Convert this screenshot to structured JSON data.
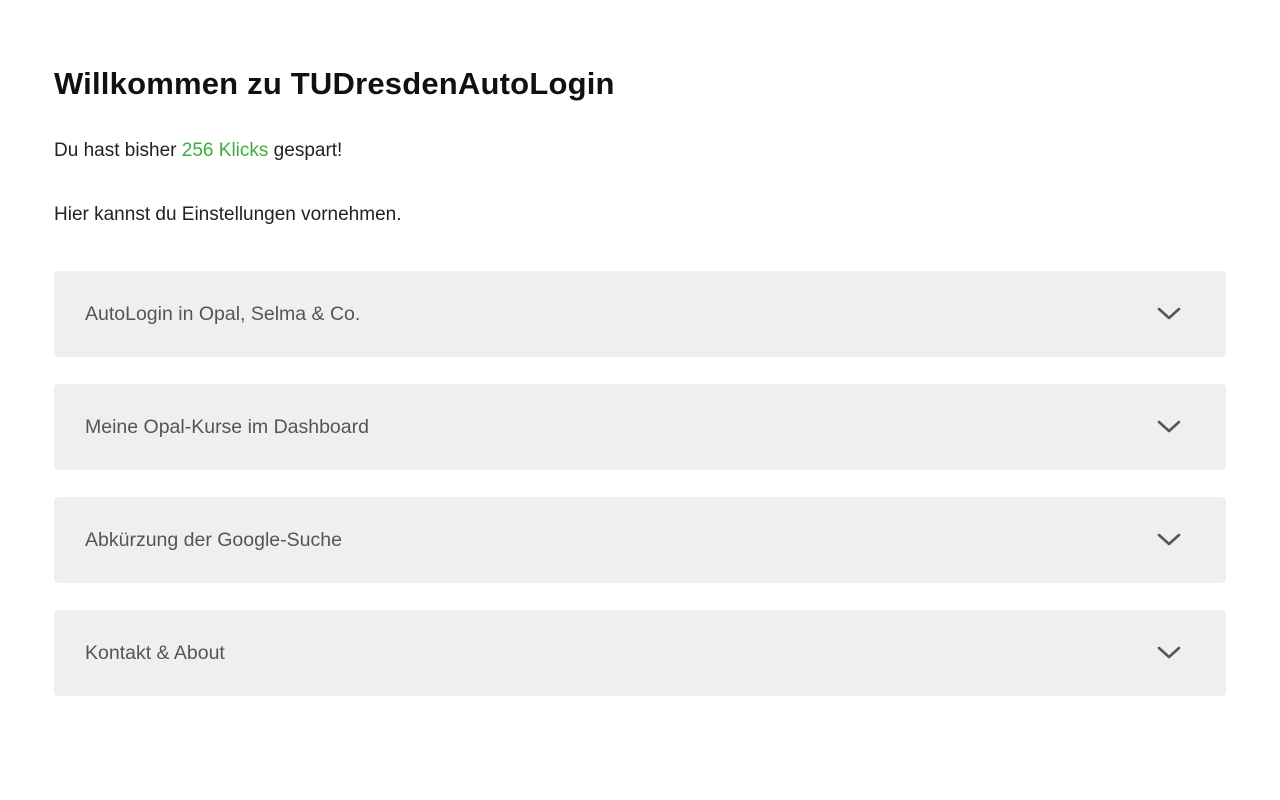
{
  "header": {
    "title": "Willkommen zu TUDresdenAutoLogin"
  },
  "stats": {
    "prefix": "Du hast bisher ",
    "count_text": "256 Klicks",
    "suffix": " gespart!",
    "highlight_color": "#3cae3c"
  },
  "intro": {
    "text": "Hier kannst du Einstellungen vornehmen."
  },
  "accordion": {
    "items": [
      {
        "label": "AutoLogin in Opal, Selma & Co.",
        "icon": "chevron-down-icon"
      },
      {
        "label": "Meine Opal-Kurse im Dashboard",
        "icon": "chevron-down-icon"
      },
      {
        "label": "Abkürzung der Google-Suche",
        "icon": "chevron-down-icon"
      },
      {
        "label": "Kontakt & About",
        "icon": "chevron-down-icon"
      }
    ]
  },
  "colors": {
    "accordion_background": "#efefef",
    "accordion_text": "#555555",
    "chevron": "#555555"
  }
}
